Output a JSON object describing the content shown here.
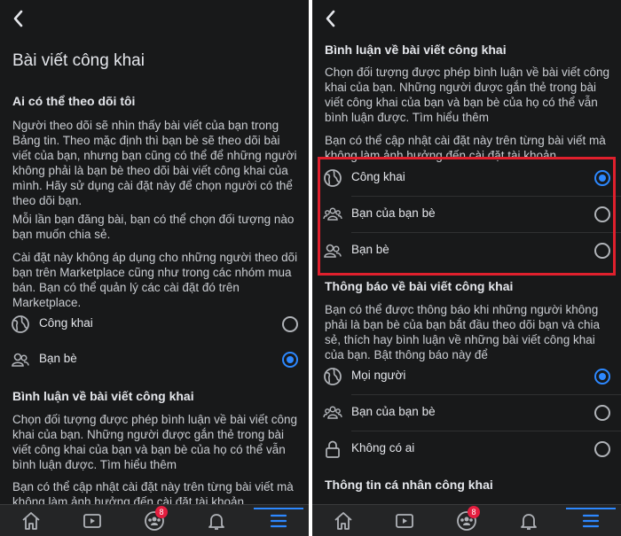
{
  "left": {
    "title": "Bài viết công khai",
    "follow_heading": "Ai có thể theo dõi tôi",
    "follow_para1": "Người theo dõi sẽ nhìn thấy bài viết của bạn trong Bảng tin. Theo mặc định thì bạn bè sẽ theo dõi bài viết của bạn, nhưng bạn cũng có thể để những người không phải là bạn bè theo dõi bài viết công khai của mình. Hãy sử dụng cài đặt này để chọn người có thể theo dõi bạn.",
    "follow_para2": "Mỗi lần bạn đăng bài, bạn có thể chọn đối tượng nào bạn muốn chia sẻ.",
    "follow_para3": "Cài đặt này không áp dụng cho những người theo dõi bạn trên Marketplace cũng như trong các nhóm mua bán. Bạn có thể quản lý các cài đặt đó trên Marketplace.",
    "follow_options": [
      {
        "label": "Công khai",
        "icon": "globe-icon",
        "selected": false
      },
      {
        "label": "Bạn bè",
        "icon": "friends-icon",
        "selected": true
      }
    ],
    "comment_heading": "Bình luận về bài viết công khai",
    "comment_para1": "Chọn đối tượng được phép bình luận về bài viết công khai của bạn. Những người được gắn thẻ trong bài viết công khai của bạn và bạn bè của họ có thể vẫn bình luận được. Tìm hiểu thêm",
    "comment_para2": "Bạn có thể cập nhật cài đặt này trên từng bài viết mà không làm ảnh hưởng đến cài đặt tài khoản."
  },
  "right": {
    "comment_heading": "Bình luận về bài viết công khai",
    "comment_para1": "Chọn đối tượng được phép bình luận về bài viết công khai của bạn. Những người được gắn thẻ trong bài viết công khai của bạn và bạn bè của họ có thể vẫn bình luận được. Tìm hiểu thêm",
    "comment_para2": "Bạn có thể cập nhật cài đặt này trên từng bài viết mà không làm ảnh hưởng đến cài đặt tài khoản.",
    "comment_options": [
      {
        "label": "Công khai",
        "icon": "globe-icon",
        "selected": true
      },
      {
        "label": "Bạn của bạn bè",
        "icon": "friends-of-friends-icon",
        "selected": false
      },
      {
        "label": "Bạn bè",
        "icon": "friends-icon",
        "selected": false
      }
    ],
    "notify_heading": "Thông báo về bài viết công khai",
    "notify_para": "Bạn có thể được thông báo khi những người không phải là bạn bè của bạn bắt đầu theo dõi bạn và chia sẻ, thích hay bình luận về những bài viết công khai của bạn. Bật thông báo này để",
    "notify_options": [
      {
        "label": "Mọi người",
        "icon": "globe-icon",
        "selected": true
      },
      {
        "label": "Bạn của bạn bè",
        "icon": "friends-of-friends-icon",
        "selected": false
      },
      {
        "label": "Không có ai",
        "icon": "lock-icon",
        "selected": false
      }
    ],
    "info_heading": "Thông tin cá nhân công khai"
  },
  "tabbar": {
    "groups_badge": "8",
    "items": [
      "home-icon",
      "watch-icon",
      "groups-icon",
      "notifications-icon",
      "menu-icon"
    ],
    "active": "menu-icon"
  },
  "colors": {
    "background": "#18191a",
    "accent": "#2d88ff",
    "highlight": "#e0202d",
    "badge": "#e41e3f"
  }
}
